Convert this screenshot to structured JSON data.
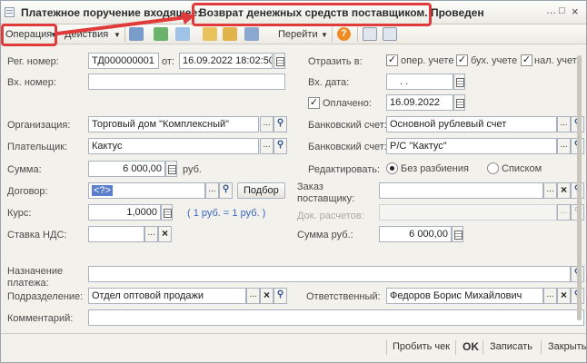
{
  "window": {
    "title": "Платежное поручение входящее: Возврат денежных средств поставщиком. Проведен",
    "title_left": "Платежное поручение входящее: ",
    "title_highlight": "Возврат денежных средств поставщиком. Проведен",
    "controls": [
      "…",
      "□",
      "×"
    ]
  },
  "toolbar": {
    "operation_label": "Операция",
    "actions_label": "Действия",
    "goto_label": "Перейти",
    "help_label": "?"
  },
  "header": {
    "reg_number_label": "Рег. номер:",
    "reg_number_value": "ТД000000001",
    "from_label": "от:",
    "from_value": "16.09.2022 18:02:50",
    "reflect_label": "Отразить в:",
    "reflect_options": [
      {
        "label": "опер. учете",
        "checked": true
      },
      {
        "label": "бух. учете",
        "checked": true
      },
      {
        "label": "нал. учете",
        "checked": true
      }
    ],
    "incoming_number_label": "Вх. номер:",
    "incoming_number_value": "",
    "incoming_date_label": "Вх. дата:",
    "incoming_date_value": ". .",
    "paid_label": "Оплачено:",
    "paid_checked": true,
    "paid_date": "16.09.2022"
  },
  "form": {
    "organization_label": "Организация:",
    "organization_value": "Торговый дом \"Комплексный\"",
    "bank_account_label": "Банковский счет:",
    "bank_account_value": "Основной рублевый счет",
    "payer_label": "Плательщик:",
    "payer_value": "Кактус",
    "payer_account_label": "Банковский счет:",
    "payer_account_value": "Р/С \"Кактус\"",
    "sum_label": "Сумма:",
    "sum_value": "6 000,00",
    "currency": "руб.",
    "edit_label": "Редактировать:",
    "edit_options": [
      {
        "label": "Без разбиения",
        "selected": true
      },
      {
        "label": "Списком",
        "selected": false
      }
    ],
    "contract_label": "Договор:",
    "contract_value": "<?>",
    "podbor_label": "Подбор",
    "supplier_order_label": "Заказ поставщику:",
    "supplier_order_value": "",
    "rate_label": "Курс:",
    "rate_value": "1,0000",
    "rate_note": "( 1 руб. = 1 руб. )",
    "settlement_doc_label": "Док. расчетов:",
    "settlement_doc_value": "",
    "vat_label": "Ставка НДС:",
    "vat_value": "",
    "sum_rub_label": "Сумма руб.:",
    "sum_rub_value": "6 000,00",
    "purpose_label": "Назначение платежа:",
    "purpose_value": "",
    "department_label": "Подразделение:",
    "department_value": "Отдел оптовой продажи",
    "responsible_label": "Ответственный:",
    "responsible_value": "Федоров Борис Михайлович",
    "comment_label": "Комментарий:",
    "comment_value": ""
  },
  "footer": {
    "print_check": "Пробить чек",
    "ok": "OK",
    "save": "Записать",
    "close": "Закрыть"
  },
  "colors": {
    "annotation": "#e03a3a",
    "selection": "#5b7fcc",
    "rate_note": "#3a67c7"
  }
}
